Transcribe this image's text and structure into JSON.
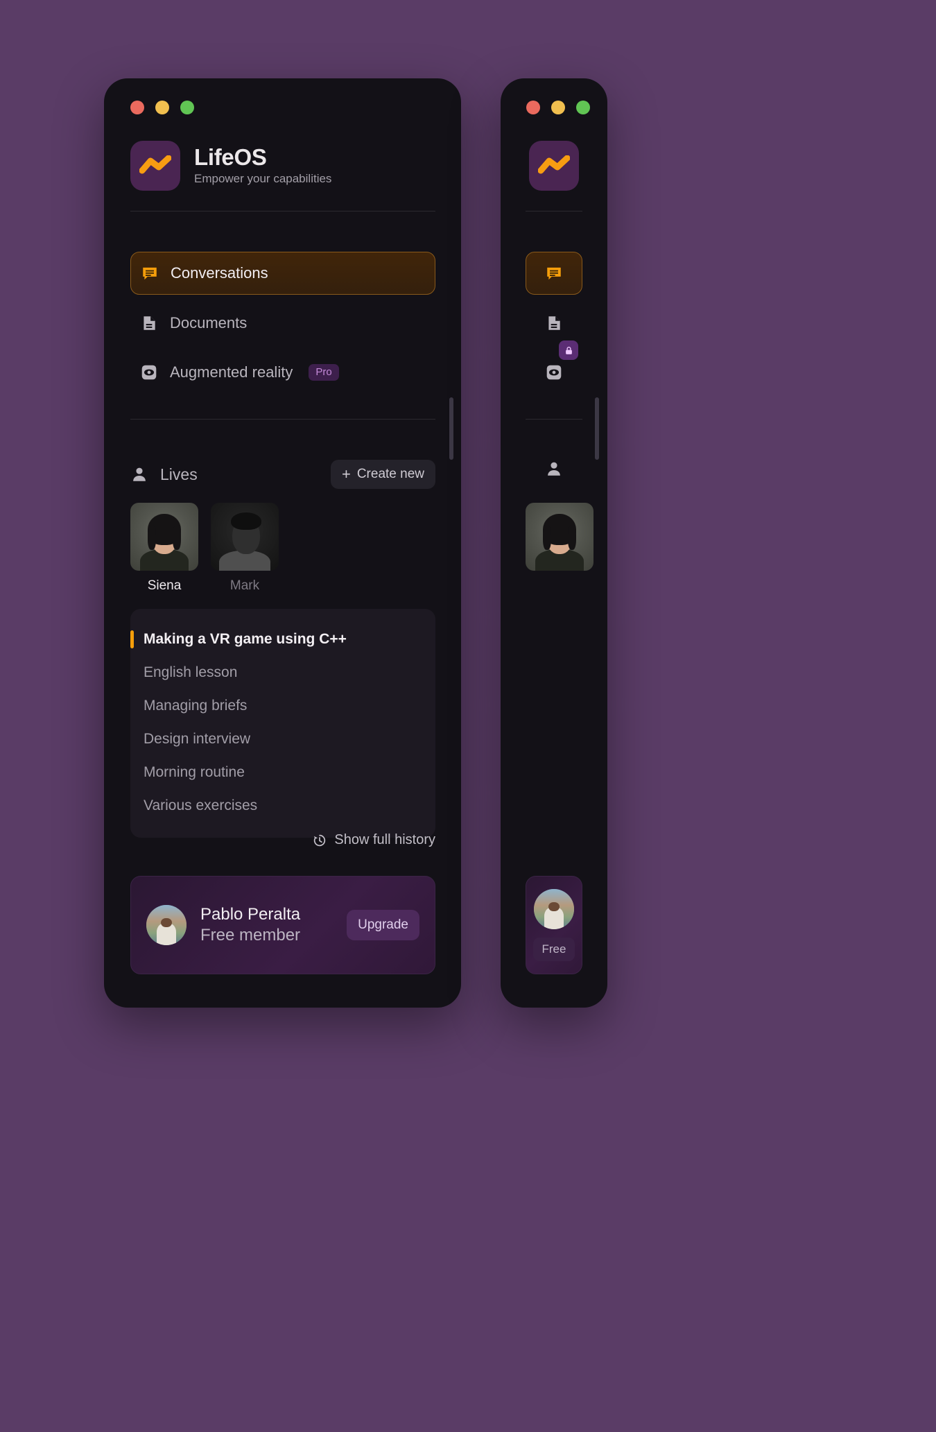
{
  "window_controls": {
    "close": "close",
    "minimize": "minimize",
    "maximize": "maximize"
  },
  "brand": {
    "title": "LifeOS",
    "subtitle": "Empower your capabilities",
    "logo_icon": "wave-logo-icon",
    "logo_bg": "#4a2552",
    "logo_stroke": "#f79d12"
  },
  "nav": {
    "items": [
      {
        "label": "Conversations",
        "icon": "chat-bubble-icon",
        "active": true,
        "badge": ""
      },
      {
        "label": "Documents",
        "icon": "document-icon",
        "active": false,
        "badge": ""
      },
      {
        "label": "Augmented reality",
        "icon": "eye-icon",
        "active": false,
        "badge": "Pro"
      }
    ]
  },
  "lives": {
    "title": "Lives",
    "icon": "person-icon",
    "create_label": "Create new",
    "create_icon": "plus-icon",
    "people": [
      {
        "name": "Siena",
        "active": true
      },
      {
        "name": "Mark",
        "active": false
      }
    ]
  },
  "conversations": {
    "items": [
      {
        "label": "Making a VR game using C++",
        "current": true
      },
      {
        "label": "English lesson",
        "current": false
      },
      {
        "label": "Managing briefs",
        "current": false
      },
      {
        "label": "Design interview",
        "current": false
      },
      {
        "label": "Morning routine",
        "current": false
      },
      {
        "label": "Various exercises",
        "current": false
      }
    ]
  },
  "history": {
    "label": "Show full history",
    "icon": "clock-history-icon"
  },
  "account": {
    "name": "Pablo Peralta",
    "plan": "Free member",
    "upgrade_label": "Upgrade",
    "rail_plan_label": "Free",
    "avatar": "user-photo-avatar"
  },
  "colors": {
    "page_bg": "#5a3c66",
    "window_bg": "#131117",
    "accent_orange": "#f59e0b",
    "active_nav_bg": "#41250a",
    "active_nav_border": "#8a5a1b",
    "pro_badge_bg": "#3d1f4c",
    "pro_badge_text": "#c48ad8",
    "upgrade_bg": "#4d2a5c"
  }
}
